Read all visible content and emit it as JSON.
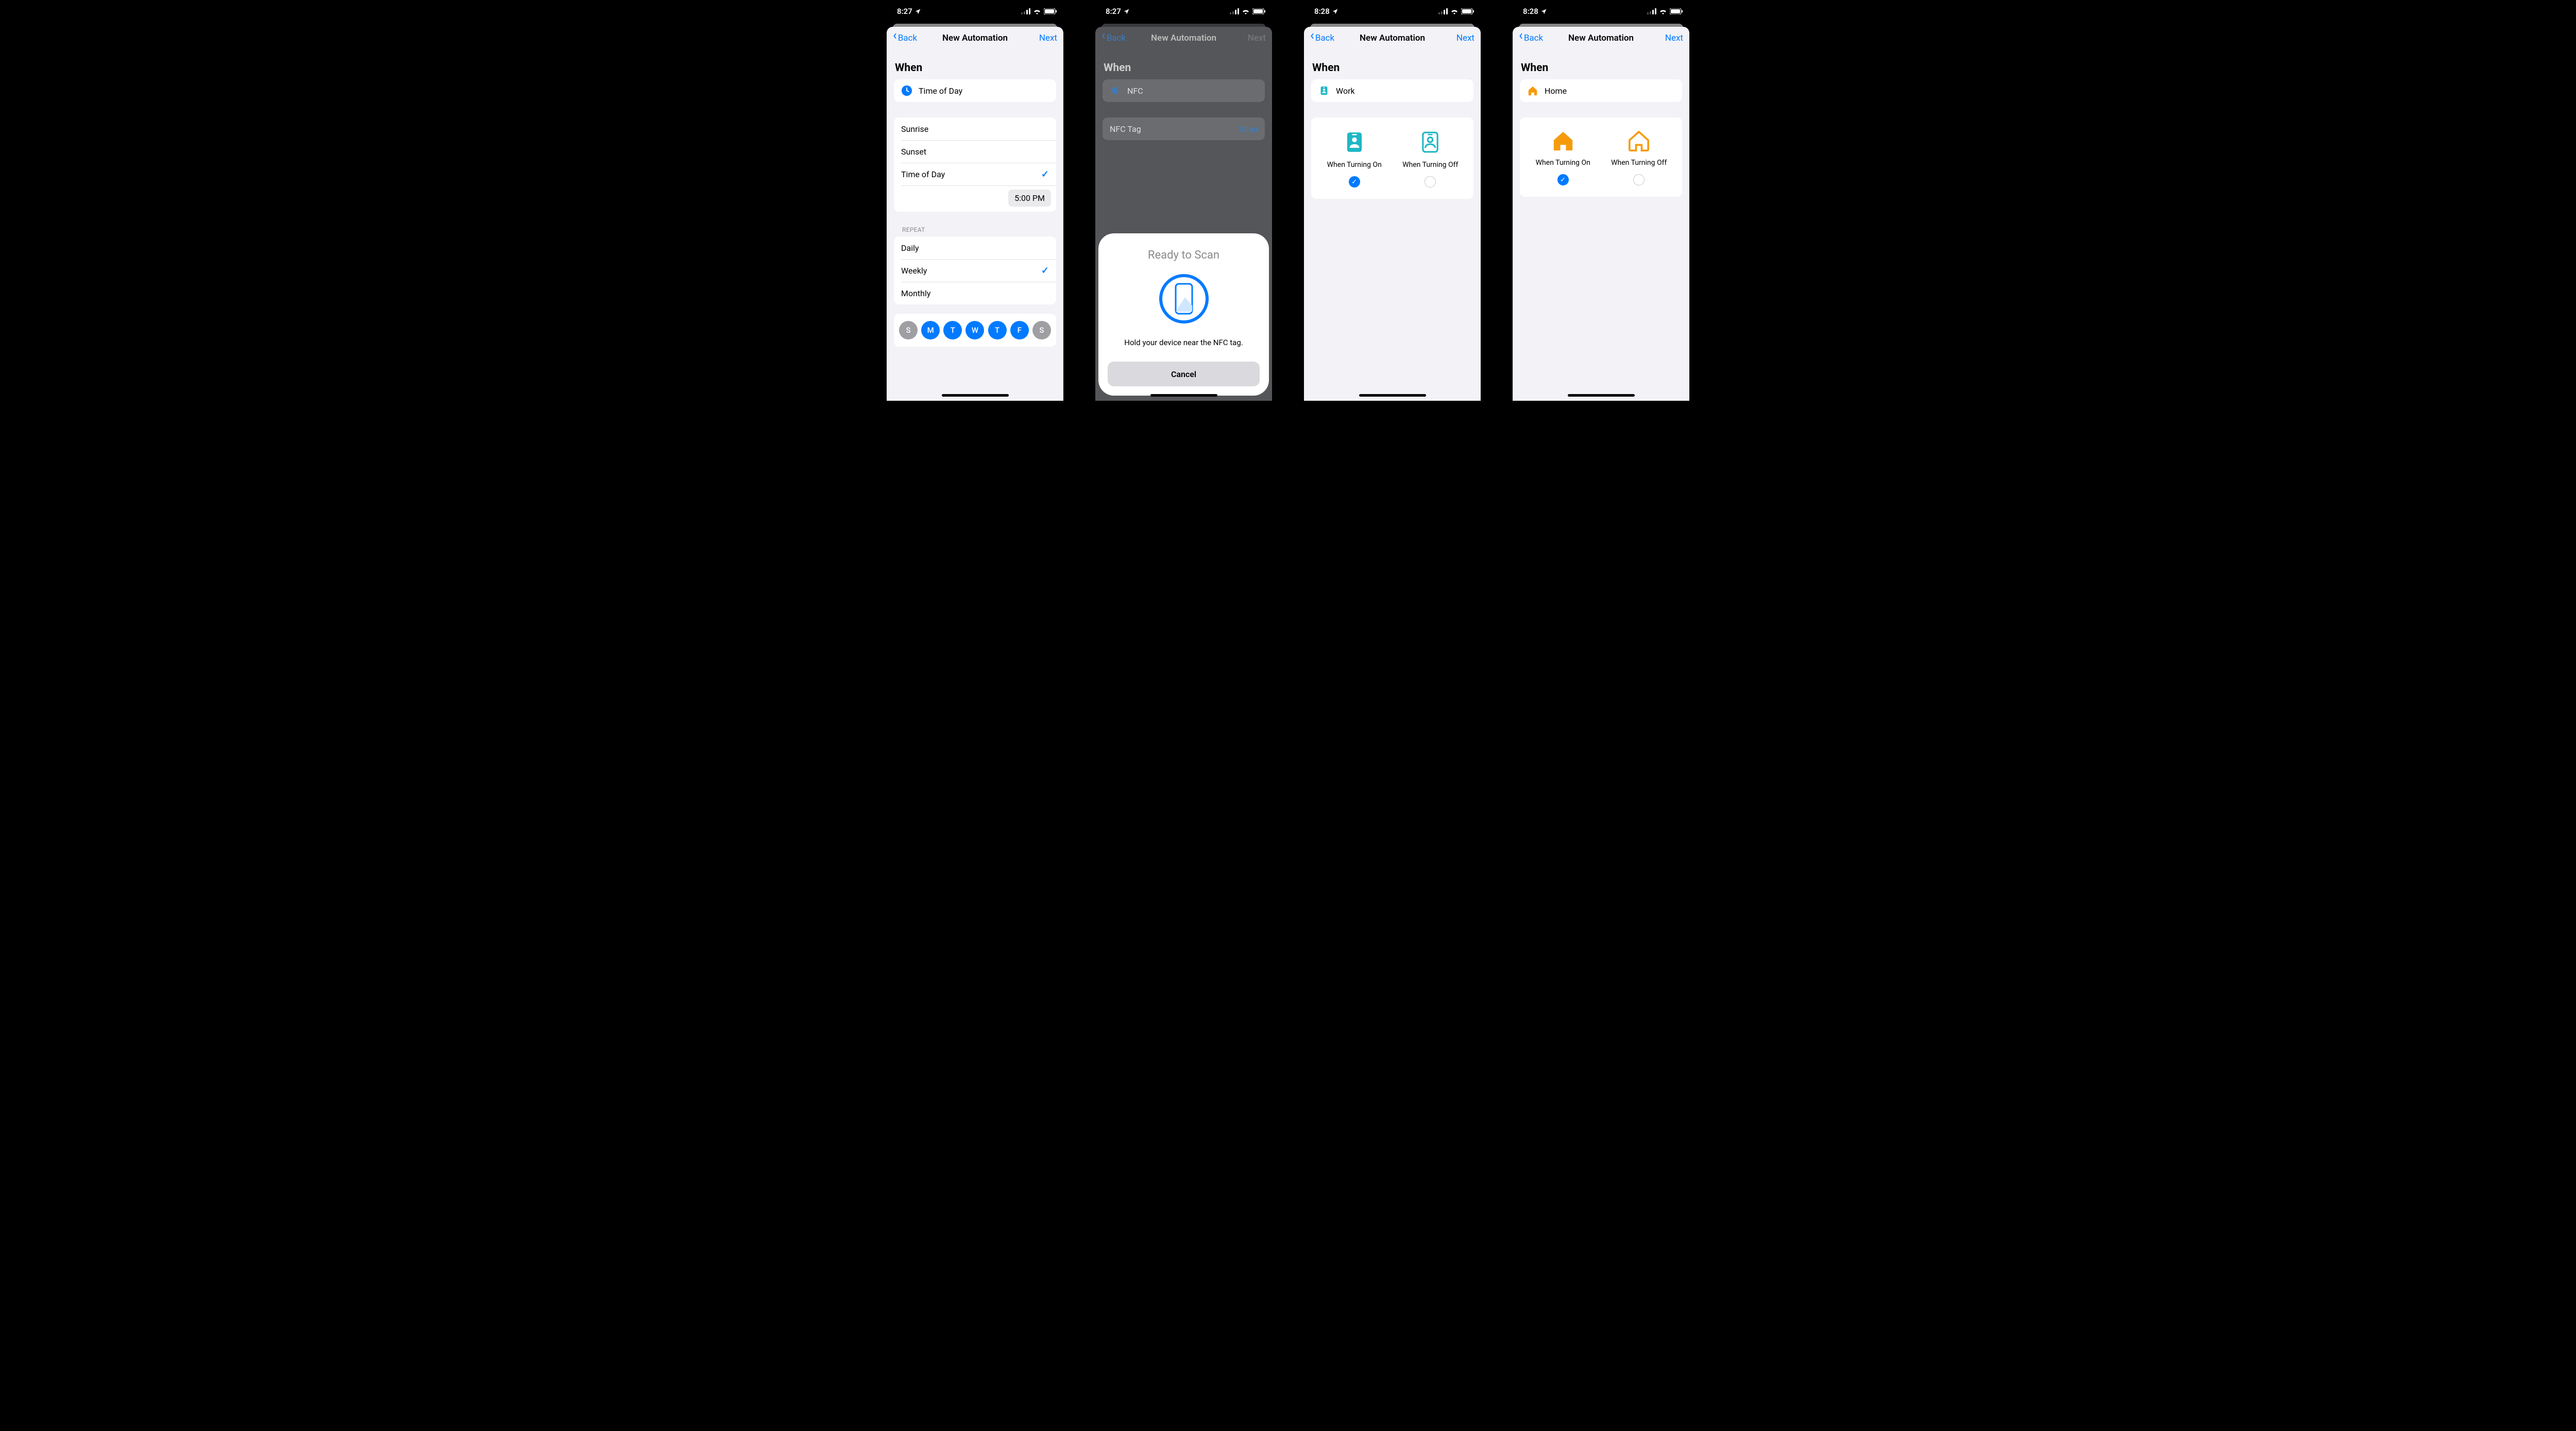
{
  "status": {
    "time_a": "8:27",
    "time_b": "8:28",
    "location_icon": "location-arrow-icon",
    "signal_icon": "cellular-signal-icon",
    "wifi_icon": "wifi-icon",
    "battery_icon": "battery-icon"
  },
  "nav": {
    "back": "Back",
    "title": "New Automation",
    "next": "Next"
  },
  "screen1": {
    "section": "When",
    "trigger_label": "Time of Day",
    "options": [
      "Sunrise",
      "Sunset",
      "Time of Day"
    ],
    "selected_option": "Time of Day",
    "time_value": "5:00 PM",
    "repeat_header": "REPEAT",
    "repeat_options": [
      "Daily",
      "Weekly",
      "Monthly"
    ],
    "repeat_selected": "Weekly",
    "days": [
      {
        "letter": "S",
        "on": false
      },
      {
        "letter": "M",
        "on": true
      },
      {
        "letter": "T",
        "on": true
      },
      {
        "letter": "W",
        "on": true
      },
      {
        "letter": "T",
        "on": true
      },
      {
        "letter": "F",
        "on": true
      },
      {
        "letter": "S",
        "on": false
      }
    ]
  },
  "screen2": {
    "section": "When",
    "trigger_label": "NFC",
    "tag_row_label": "NFC Tag",
    "scan_action": "Scan",
    "panel_title": "Ready to Scan",
    "panel_msg": "Hold your device near the NFC tag.",
    "cancel": "Cancel"
  },
  "screen3": {
    "section": "When",
    "trigger_label": "Work",
    "choice_on": "When Turning On",
    "choice_off": "When Turning Off",
    "selected": "on"
  },
  "screen4": {
    "section": "When",
    "trigger_label": "Home",
    "choice_on": "When Turning On",
    "choice_off": "When Turning Off",
    "selected": "on"
  },
  "colors": {
    "accent": "#007aff",
    "focus_work": "#1fb7c4",
    "focus_home": "#f59b0b"
  }
}
